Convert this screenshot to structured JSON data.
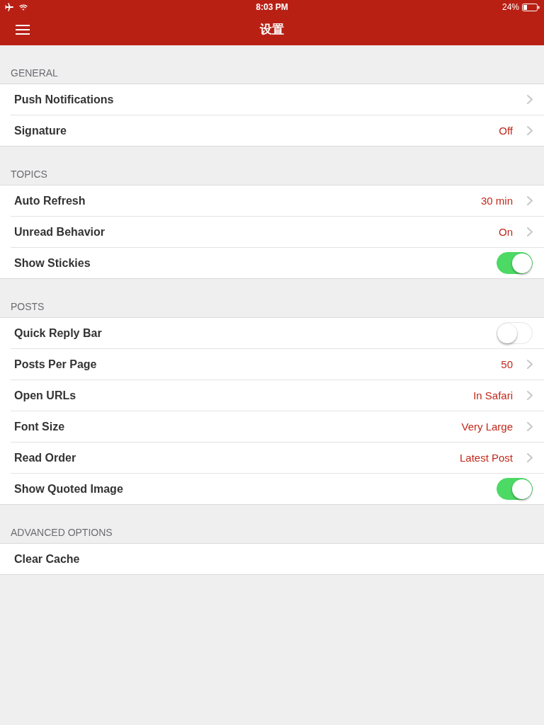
{
  "status_bar": {
    "time": "8:03 PM",
    "battery": "24%"
  },
  "nav_bar": {
    "title": "设置"
  },
  "sections": [
    {
      "header": "GENERAL",
      "rows": [
        {
          "kind": "disclosure",
          "label": "Push Notifications"
        },
        {
          "kind": "disclosure",
          "label": "Signature",
          "value": "Off"
        }
      ]
    },
    {
      "header": "TOPICS",
      "rows": [
        {
          "kind": "disclosure",
          "label": "Auto Refresh",
          "value": "30 min"
        },
        {
          "kind": "disclosure",
          "label": "Unread Behavior",
          "value": "On"
        },
        {
          "kind": "toggle",
          "label": "Show Stickies",
          "on": true
        }
      ]
    },
    {
      "header": "POSTS",
      "rows": [
        {
          "kind": "toggle",
          "label": "Quick Reply Bar",
          "on": false
        },
        {
          "kind": "disclosure",
          "label": "Posts Per Page",
          "value": "50"
        },
        {
          "kind": "disclosure",
          "label": "Open URLs",
          "value": "In Safari"
        },
        {
          "kind": "disclosure",
          "label": "Font Size",
          "value": "Very Large"
        },
        {
          "kind": "disclosure",
          "label": "Read Order",
          "value": "Latest Post"
        },
        {
          "kind": "toggle",
          "label": "Show Quoted Image",
          "on": true
        }
      ]
    },
    {
      "header": "ADVANCED OPTIONS",
      "rows": [
        {
          "kind": "action",
          "label": "Clear Cache"
        }
      ]
    }
  ]
}
